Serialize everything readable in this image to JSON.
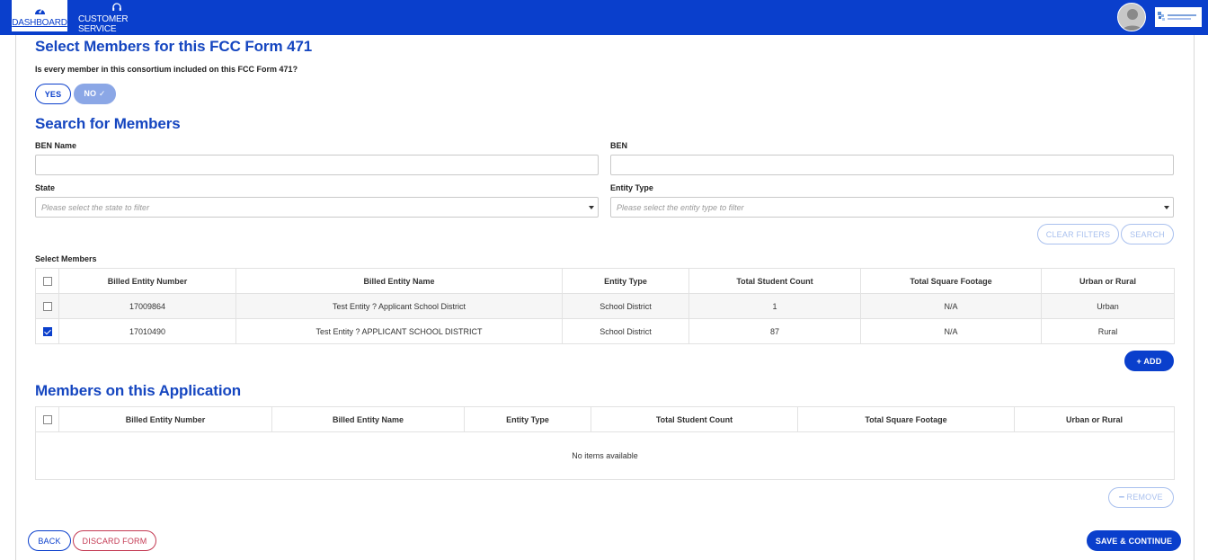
{
  "nav": {
    "dashboard": "DASHBOARD",
    "customer_service": "CUSTOMER SERVICE"
  },
  "colors": {
    "brand": "#0a3fcc",
    "heading": "#1546c0",
    "danger": "#c43a53"
  },
  "select_section": {
    "title": "Select Members for this FCC Form 471",
    "question": "Is every member in this consortium included on this FCC Form 471?",
    "yes_label": "YES",
    "no_label": "NO ✓",
    "selected": "NO"
  },
  "search": {
    "title": "Search for Members",
    "ben_name_label": "BEN Name",
    "ben_name_value": "",
    "ben_label": "BEN",
    "ben_value": "",
    "state_label": "State",
    "state_placeholder": "Please select the state to filter",
    "entity_type_label": "Entity Type",
    "entity_type_placeholder": "Please select the entity type to filter",
    "clear_filters_label": "CLEAR FILTERS",
    "search_label": "SEARCH"
  },
  "select_members": {
    "label": "Select Members",
    "columns": [
      "Billed Entity Number",
      "Billed Entity Name",
      "Entity Type",
      "Total Student Count",
      "Total Square Footage",
      "Urban or Rural"
    ],
    "rows": [
      {
        "checked": false,
        "ben": "17009864",
        "name": "Test Entity ? Applicant School District",
        "type": "School District",
        "students": "1",
        "sqft": "N/A",
        "urban_rural": "Urban"
      },
      {
        "checked": true,
        "ben": "17010490",
        "name": "Test Entity ? APPLICANT SCHOOL DISTRICT",
        "type": "School District",
        "students": "87",
        "sqft": "N/A",
        "urban_rural": "Rural"
      }
    ],
    "add_label": "+ ADD"
  },
  "application_members": {
    "title": "Members on this Application",
    "columns": [
      "Billed Entity Number",
      "Billed Entity Name",
      "Entity Type",
      "Total Student Count",
      "Total Square Footage",
      "Urban or Rural"
    ],
    "empty_text": "No items available",
    "remove_label": "━ REMOVE"
  },
  "footer": {
    "back_label": "BACK",
    "discard_label": "DISCARD FORM",
    "save_label": "SAVE & CONTINUE"
  }
}
